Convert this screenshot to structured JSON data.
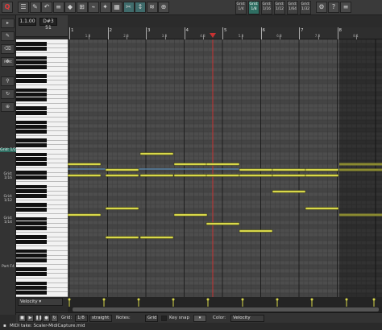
{
  "toolbar": {
    "buttons": [
      {
        "name": "toolbar-btn-1",
        "glyph": "☰"
      },
      {
        "name": "toolbar-btn-2",
        "glyph": "✎"
      },
      {
        "name": "toolbar-btn-3",
        "glyph": "↶"
      },
      {
        "name": "toolbar-btn-4",
        "glyph": "≡"
      },
      {
        "name": "toolbar-btn-5",
        "glyph": "◆"
      },
      {
        "name": "toolbar-btn-6",
        "glyph": "⊞"
      },
      {
        "name": "toolbar-btn-7",
        "glyph": "⌁"
      },
      {
        "name": "toolbar-btn-8",
        "glyph": "✦"
      },
      {
        "name": "toolbar-btn-9",
        "glyph": "▦"
      },
      {
        "name": "toolbar-btn-10",
        "glyph": "✂"
      },
      {
        "name": "toolbar-btn-11",
        "glyph": "↕"
      },
      {
        "name": "toolbar-btn-12",
        "glyph": "≋"
      },
      {
        "name": "toolbar-btn-13",
        "glyph": "⊕"
      }
    ],
    "quantize_label": "Q",
    "grid_buttons": [
      {
        "top": "Grid:",
        "bottom": "1/4"
      },
      {
        "top": "Grid:",
        "bottom": "1/8"
      },
      {
        "top": "Grid:",
        "bottom": "1/16"
      },
      {
        "top": "Grid:",
        "bottom": "1/12"
      },
      {
        "top": "Grid:",
        "bottom": "1/64"
      },
      {
        "top": "Grid:",
        "bottom": "1/32"
      }
    ]
  },
  "position": {
    "time": "1.1.00",
    "note": "D#3 51"
  },
  "ruler": {
    "bars": [
      "1",
      "2",
      "3",
      "4",
      "5",
      "6",
      "7",
      "8"
    ],
    "beats": [
      "1.3",
      "2.3",
      "3.3",
      "4.3",
      "5.3",
      "6.3",
      "7.3",
      "8.1"
    ]
  },
  "left_toolbar": {
    "labels": [
      "Rest",
      "Grid: 1/2",
      "Grid: 1/16",
      "Grid: 1/12",
      "Grid: 1/14",
      "Part F4"
    ]
  },
  "velocity_lane": {
    "selected": "Velocity"
  },
  "bottom_bar": {
    "grid_label": "Grid:",
    "grid_value": "1/8",
    "grid_mode": "straight",
    "notes_label": "Notes:",
    "notes_value": "Grid",
    "key_snap_label": "Key snap",
    "color_label": "Color:",
    "color_value": "Velocity"
  },
  "status": {
    "text": "MIDI take: Scaler-MidiCapture.mid"
  },
  "colors": {
    "note": "#d8d84a",
    "note_border": "#2a2a10",
    "playhead": "#c83232",
    "loop_line": "#5b8db8"
  }
}
